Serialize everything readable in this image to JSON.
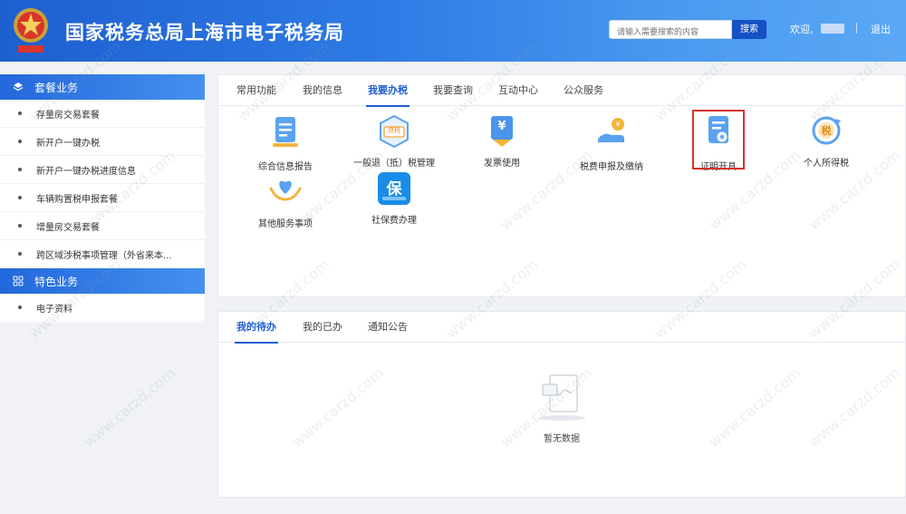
{
  "header": {
    "site_title": "国家税务总局上海市电子税务局",
    "search_placeholder": "请输入需要搜索的内容",
    "search_button": "搜索",
    "welcome": "欢迎,",
    "logout": "退出"
  },
  "sidebar": {
    "groups": [
      {
        "title": "套餐业务",
        "icon": "layers-icon",
        "items": [
          "存量房交易套餐",
          "新开户一键办税",
          "新开户一键办税进度信息",
          "车辆购置税申报套餐",
          "增量房交易套餐",
          "跨区域涉税事项管理（外省来本..."
        ]
      },
      {
        "title": "特色业务",
        "icon": "grid-icon",
        "items": [
          "电子资料"
        ]
      }
    ]
  },
  "main_tabs": [
    "常用功能",
    "我的信息",
    "我要办税",
    "我要查询",
    "互动中心",
    "公众服务"
  ],
  "main_tabs_active": "我要办税",
  "services": [
    {
      "label": "综合信息报告",
      "icon": "report-icon"
    },
    {
      "label": "一般退（抵）税管理",
      "icon": "refund-icon",
      "icon_text": "退税"
    },
    {
      "label": "发票使用",
      "icon": "invoice-icon",
      "icon_text": "¥"
    },
    {
      "label": "税费申报及缴纳",
      "icon": "declare-pay-icon"
    },
    {
      "label": "证明开具",
      "icon": "certificate-icon"
    },
    {
      "label": "个人所得税",
      "icon": "personal-tax-icon",
      "icon_text": "税"
    },
    {
      "label": "其他服务事项",
      "icon": "heart-hands-icon"
    },
    {
      "label": "社保费办理",
      "icon": "social-insurance-icon",
      "icon_text": "保"
    }
  ],
  "bottom_tabs": [
    "我的待办",
    "我的已办",
    "通知公告"
  ],
  "bottom_tabs_active": "我的待办",
  "empty_text": "暂无数据",
  "watermark": "www.carzd.com",
  "colors": {
    "header_start": "#1e5fd0",
    "accent": "#1f5fd1",
    "highlight": "#d7312a"
  }
}
